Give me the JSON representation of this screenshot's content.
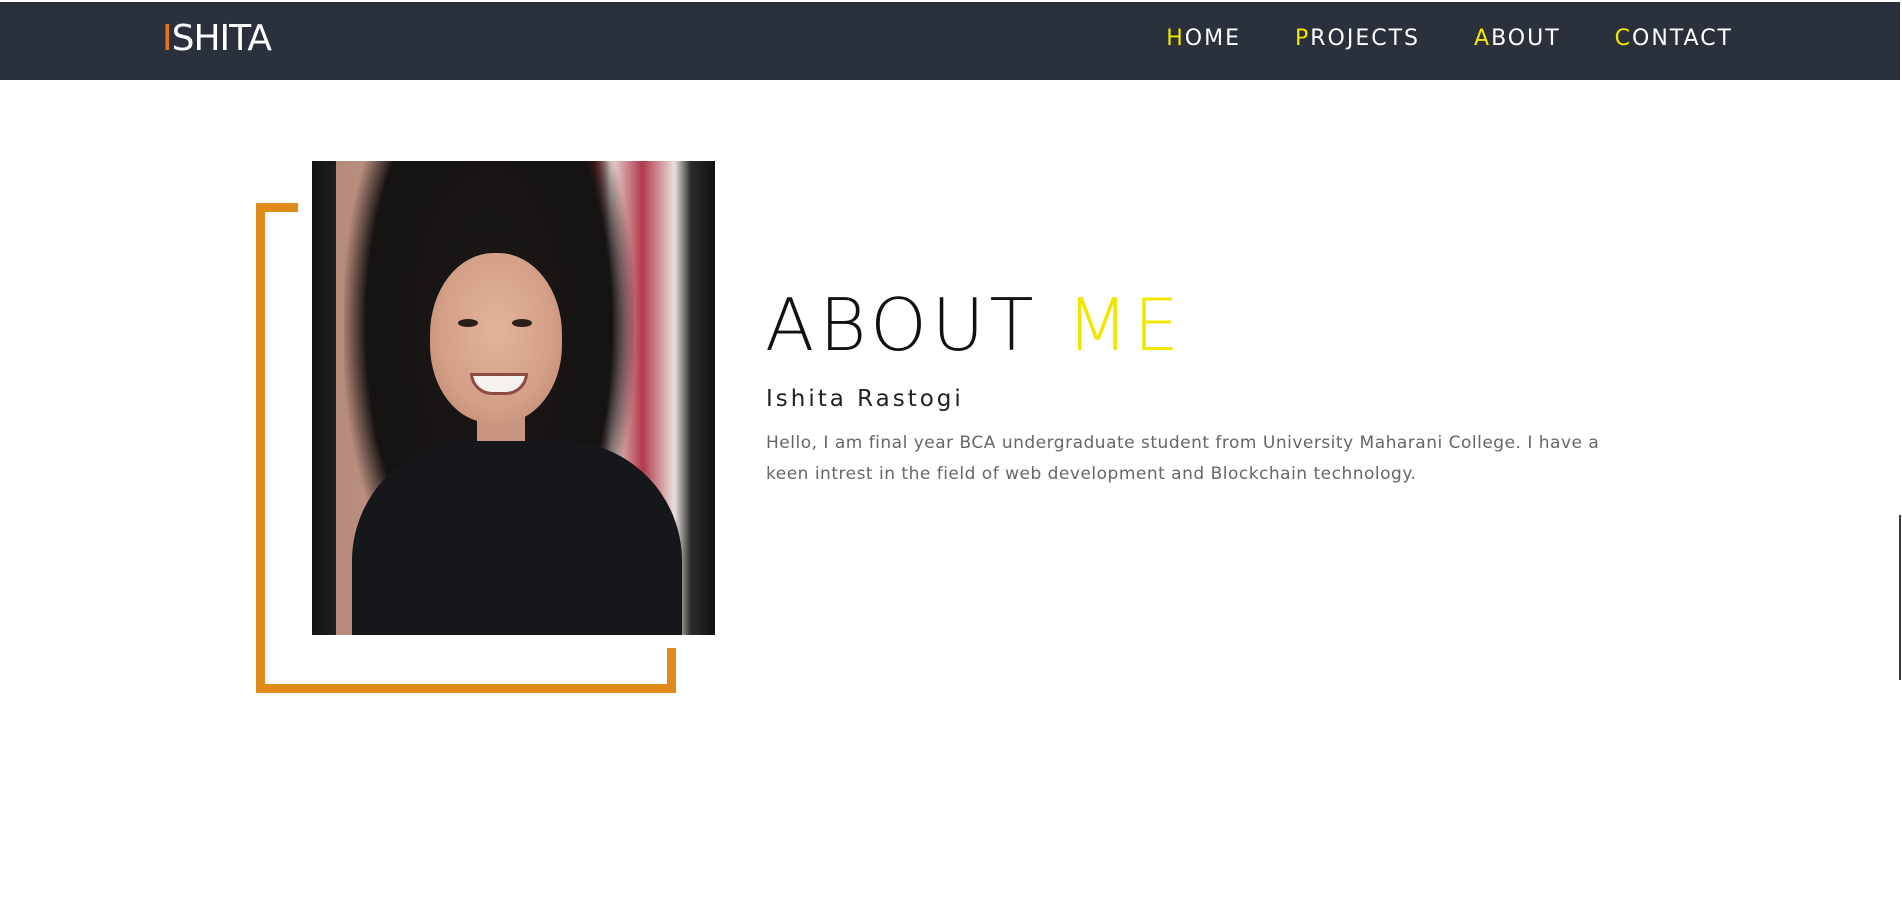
{
  "header": {
    "logo_first": "I",
    "logo_rest": "SHITA"
  },
  "nav": {
    "items": [
      {
        "first": "H",
        "rest": "OME"
      },
      {
        "first": "P",
        "rest": "ROJECTS"
      },
      {
        "first": "A",
        "rest": "BOUT"
      },
      {
        "first": "C",
        "rest": "ONTACT"
      }
    ]
  },
  "about": {
    "title_main": "ABOUT",
    "title_accent": "ME",
    "name": "Ishita Rastogi",
    "bio": "Hello, I am final year BCA undergraduate student from University Maharani College. I have a keen intrest in the field of web development and Blockchain technology."
  },
  "colors": {
    "navbar": "#2b313c",
    "logo_accent": "#f0701f",
    "nav_accent": "#f2e600",
    "frame": "#df8a1b"
  }
}
